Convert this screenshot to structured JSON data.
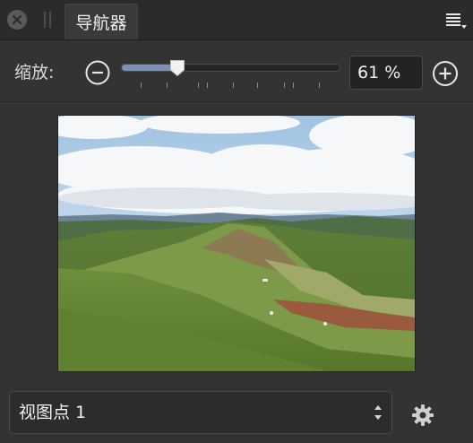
{
  "panel": {
    "tab_title": "导航器"
  },
  "zoom": {
    "label": "缩放:",
    "value": "61 %",
    "slider_fraction": 0.26
  },
  "viewpoint": {
    "selected": "视图点 1"
  },
  "icons": {
    "close": "close-icon",
    "grip": "grip-icon",
    "menu": "menu-icon",
    "zoom_out": "zoom-out-icon",
    "zoom_in": "zoom-in-icon",
    "select_arrows": "up-down-arrows-icon",
    "settings": "gear-icon"
  },
  "colors": {
    "accent": "#7a90b4",
    "panel_bg": "#333333"
  }
}
